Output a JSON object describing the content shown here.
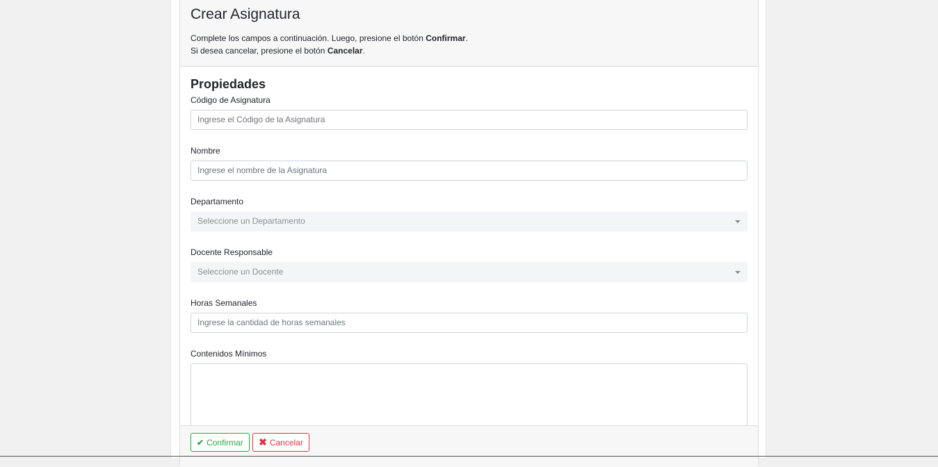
{
  "header": {
    "title": "Crear Asignatura",
    "line1_pre": "Complete los campos a continuación. Luego, presione el botón ",
    "line1_bold": "Confirmar",
    "line1_post": ".",
    "line2_pre": "Si desea cancelar, presione el botón ",
    "line2_bold": "Cancelar",
    "line2_post": "."
  },
  "form": {
    "section_title": "Propiedades",
    "codigo": {
      "label": "Código de Asignatura",
      "placeholder": "Ingrese el Código de la Asignatura",
      "value": ""
    },
    "nombre": {
      "label": "Nombre",
      "placeholder": "Ingrese el nombre de la Asignatura",
      "value": ""
    },
    "departamento": {
      "label": "Departamento",
      "selected": "Seleccione un Departamento"
    },
    "docente": {
      "label": "Docente Responsable",
      "selected": "Seleccione un Docente"
    },
    "horas": {
      "label": "Horas Semanales",
      "placeholder": "Ingrese la cantidad de horas semanales",
      "value": ""
    },
    "contenidos": {
      "label": "Contenidos Mínimos",
      "value": ""
    }
  },
  "footer": {
    "confirm_label": "Confirmar",
    "cancel_label": "Cancelar",
    "confirm_icon": "check-icon",
    "cancel_icon": "times-icon"
  },
  "colors": {
    "success": "#28a745",
    "danger": "#dc3545"
  }
}
